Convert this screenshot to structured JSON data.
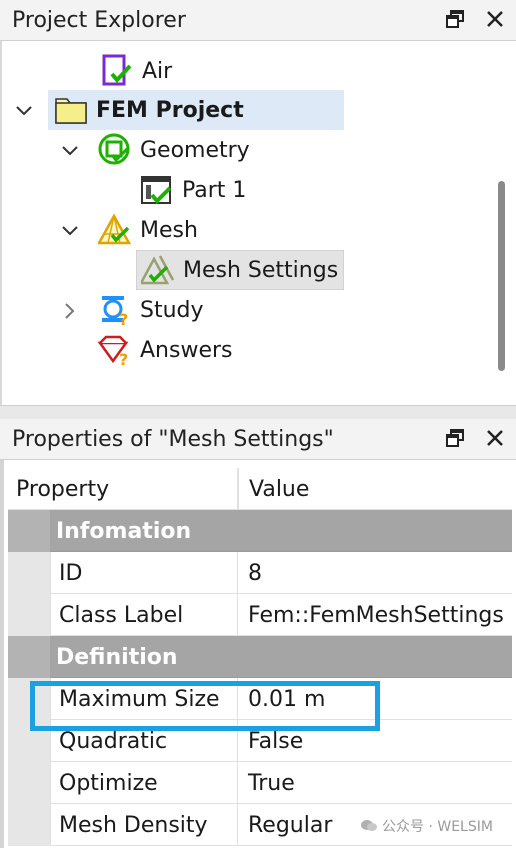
{
  "explorer": {
    "title": "Project Explorer",
    "items": [
      {
        "label": "Air"
      },
      {
        "label": "FEM Project"
      },
      {
        "label": "Geometry"
      },
      {
        "label": "Part 1"
      },
      {
        "label": "Mesh"
      },
      {
        "label": "Mesh Settings"
      },
      {
        "label": "Study"
      },
      {
        "label": "Answers"
      }
    ]
  },
  "properties": {
    "title": "Properties of \"Mesh Settings\"",
    "columns": [
      "Property",
      "Value"
    ],
    "groups": [
      {
        "label": "Infomation",
        "rows": [
          {
            "name": "ID",
            "value": "8"
          },
          {
            "name": "Class Label",
            "value": "Fem::FemMeshSettings"
          }
        ]
      },
      {
        "label": "Definition",
        "rows": [
          {
            "name": "Maximum Size",
            "value": "0.01 m"
          },
          {
            "name": "Quadratic",
            "value": "False"
          },
          {
            "name": "Optimize",
            "value": "True"
          },
          {
            "name": "Mesh Density",
            "value": "Regular"
          }
        ]
      }
    ]
  },
  "watermark": "公众号 · WELSIM",
  "colors": {
    "highlight": "#1ba1e2",
    "selected_bg": "#dde9f7",
    "group_bg": "#a5a5a5"
  }
}
